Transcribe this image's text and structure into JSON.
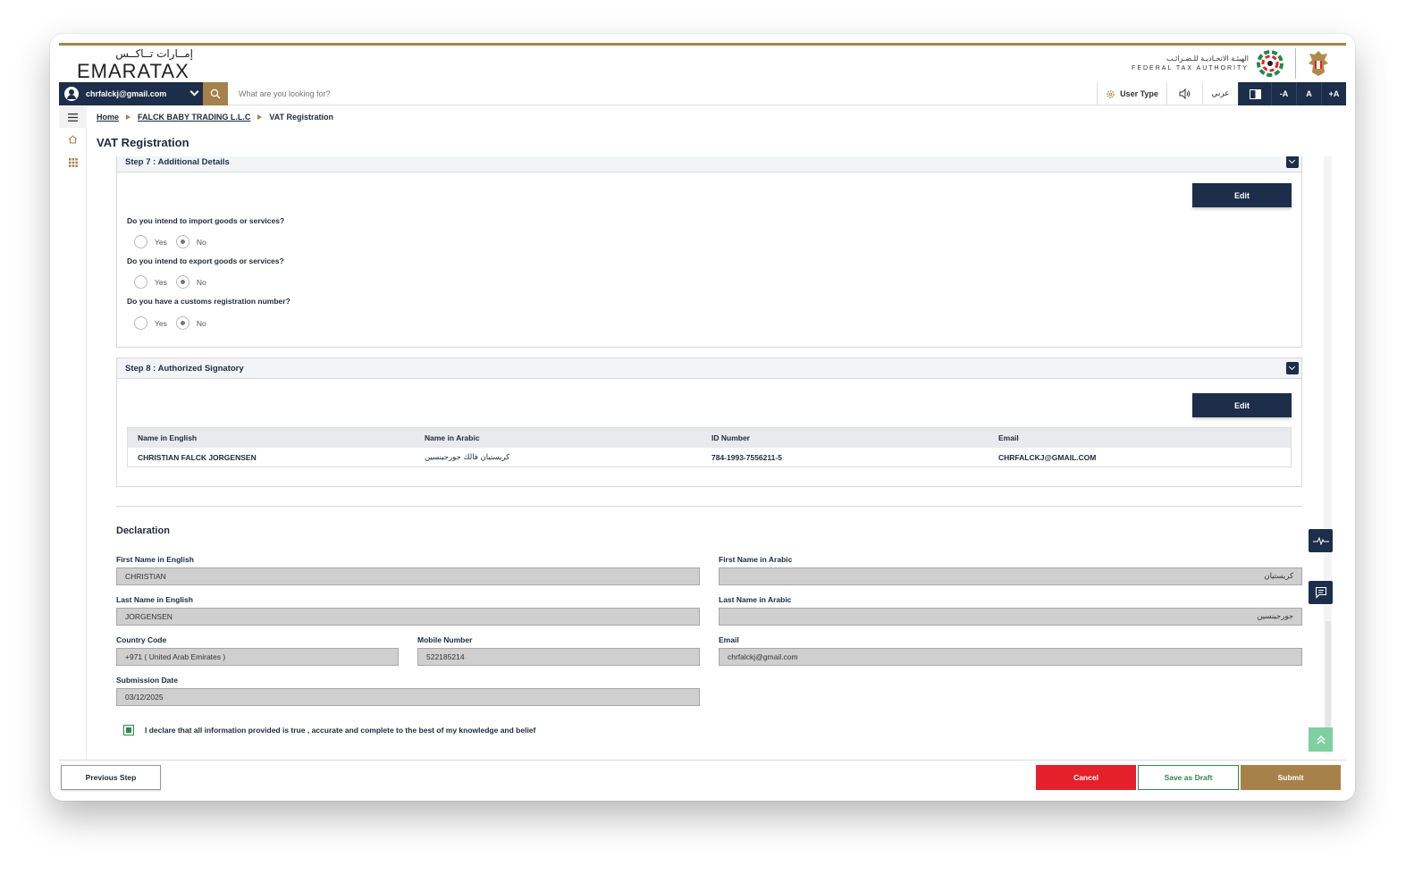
{
  "brand": {
    "logo_arabic": "إمــارات تــاكــس",
    "logo_english": "EMARATAX",
    "authority_arabic": "الهيئـة الاتحـاديـة للـضـرائـب",
    "authority_english": "FEDERAL TAX AUTHORITY"
  },
  "topbar": {
    "user_email": "chrfalckj@gmail.com",
    "search_placeholder": "What are you looking for?",
    "user_type_label": "User Type",
    "language_toggle": "عربي",
    "font_decrease": "-A",
    "font_reset": "A",
    "font_increase": "+A"
  },
  "breadcrumb": {
    "home": "Home",
    "company": "FALCK BABY TRADING L.L.C",
    "current": "VAT Registration"
  },
  "page": {
    "title": "VAT Registration"
  },
  "step7": {
    "title": "Step 7 : Additional Details",
    "edit_label": "Edit",
    "questions": [
      {
        "label": "Do you intend to import goods or services?",
        "yes": "Yes",
        "no": "No",
        "selected": "No"
      },
      {
        "label": "Do you intend to export goods or services?",
        "yes": "Yes",
        "no": "No",
        "selected": "No"
      },
      {
        "label": "Do you have a customs registration number?",
        "yes": "Yes",
        "no": "No",
        "selected": "No"
      }
    ]
  },
  "step8": {
    "title": "Step 8 : Authorized Signatory",
    "edit_label": "Edit",
    "columns": [
      "Name in English",
      "Name in Arabic",
      "ID Number",
      "Email"
    ],
    "rows": [
      [
        "CHRISTIAN FALCK JORGENSEN",
        "كريستيان فالك جورجينسين",
        "784-1993-7556211-5",
        "CHRFALCKJ@GMAIL.COM"
      ]
    ]
  },
  "declaration": {
    "title": "Declaration",
    "first_name_en_label": "First Name in English",
    "first_name_en": "CHRISTIAN",
    "first_name_ar_label": "First Name in Arabic",
    "first_name_ar": "كريستيان",
    "last_name_en_label": "Last Name in English",
    "last_name_en": "JORGENSEN",
    "last_name_ar_label": "Last Name in Arabic",
    "last_name_ar": "جورجينسين",
    "country_code_label": "Country Code",
    "country_code": "+971 ( United Arab Emirates )",
    "mobile_label": "Mobile Number",
    "mobile": "522185214",
    "email_label": "Email",
    "email": "chrfalckj@gmail.com",
    "submission_date_label": "Submission Date",
    "submission_date": "03/12/2025",
    "consent_text": "I declare that all information provided is true , accurate and complete to the best of my knowledge and belief",
    "consent_checked": true
  },
  "footer": {
    "previous_label": "Previous Step",
    "cancel_label": "Cancel",
    "draft_label": "Save as Draft",
    "submit_label": "Submit"
  },
  "colors": {
    "navy": "#1c2e4a",
    "gold": "#a6814a",
    "red": "#e4212b",
    "green": "#2a8a4e"
  }
}
